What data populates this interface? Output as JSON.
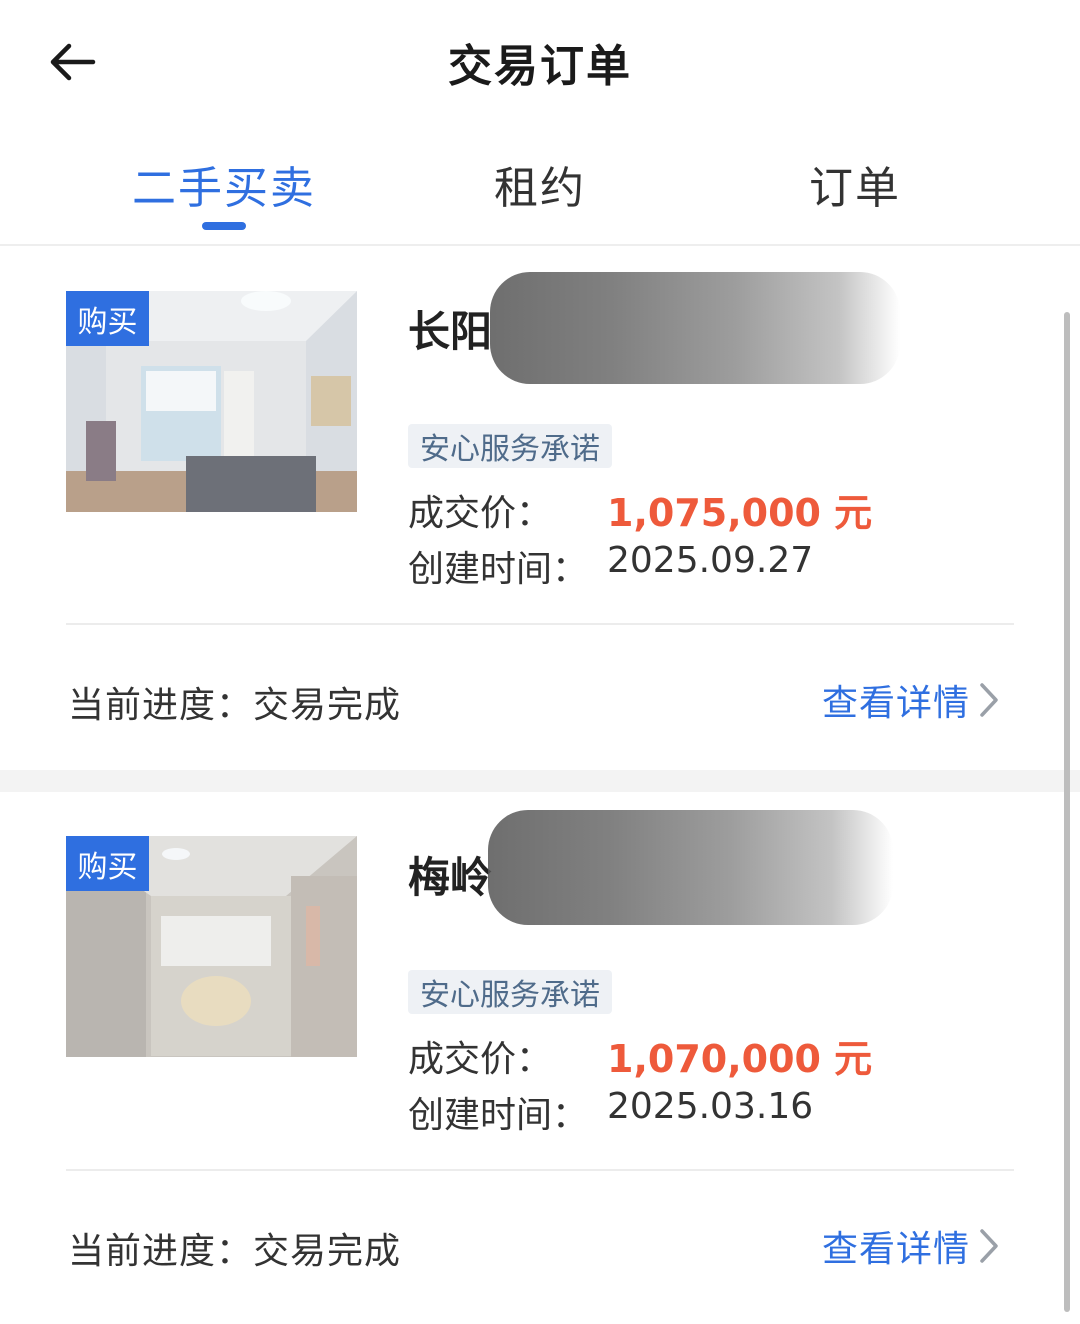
{
  "header": {
    "title": "交易订单",
    "back_icon": "back-arrow-icon"
  },
  "tabs": [
    {
      "label": "二手买卖",
      "active": true
    },
    {
      "label": "租约",
      "active": false
    },
    {
      "label": "订单",
      "active": false
    }
  ],
  "orders": [
    {
      "tag": "购买",
      "title_visible": "长阳",
      "badge": "安心服务承诺",
      "price_label": "成交价：",
      "price_value": "1,075,000 元",
      "created_label": "创建时间：",
      "created_value": "2025.09.27",
      "progress_label": "当前进度：",
      "progress_value": "交易完成",
      "detail_label": "查看详情"
    },
    {
      "tag": "购买",
      "title_visible": "梅岭",
      "badge": "安心服务承诺",
      "price_label": "成交价：",
      "price_value": "1,070,000 元",
      "created_label": "创建时间：",
      "created_value": "2025.03.16",
      "progress_label": "当前进度：",
      "progress_value": "交易完成",
      "detail_label": "查看详情"
    }
  ],
  "colors": {
    "accent": "#2f6fe0",
    "price": "#ee5a3b",
    "badge_bg": "#eef1f5",
    "badge_text": "#4f6b8a"
  }
}
